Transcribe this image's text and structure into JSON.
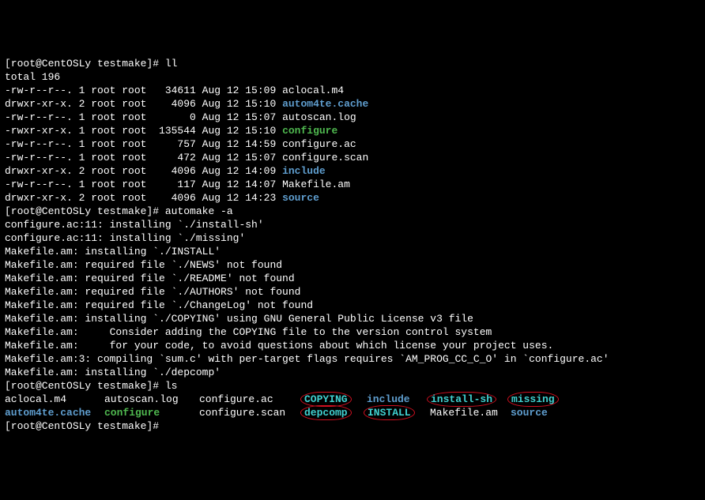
{
  "prompt": {
    "user": "root",
    "host": "CentOSLy",
    "dir": "testmake",
    "symbol": "#"
  },
  "cmd1": "ll",
  "total_line": "total 196",
  "listing": [
    {
      "perm": "-rw-r--r--.",
      "links": "1",
      "owner": "root",
      "group": "root",
      "size": "  34611",
      "date": "Aug 12 15:09",
      "name": "aclocal.m4",
      "cls": "white"
    },
    {
      "perm": "drwxr-xr-x.",
      "links": "2",
      "owner": "root",
      "group": "root",
      "size": "   4096",
      "date": "Aug 12 15:10",
      "name": "autom4te.cache",
      "cls": "dir"
    },
    {
      "perm": "-rw-r--r--.",
      "links": "1",
      "owner": "root",
      "group": "root",
      "size": "      0",
      "date": "Aug 12 15:07",
      "name": "autoscan.log",
      "cls": "white"
    },
    {
      "perm": "-rwxr-xr-x.",
      "links": "1",
      "owner": "root",
      "group": "root",
      "size": " 135544",
      "date": "Aug 12 15:10",
      "name": "configure",
      "cls": "exec"
    },
    {
      "perm": "-rw-r--r--.",
      "links": "1",
      "owner": "root",
      "group": "root",
      "size": "    757",
      "date": "Aug 12 14:59",
      "name": "configure.ac",
      "cls": "white"
    },
    {
      "perm": "-rw-r--r--.",
      "links": "1",
      "owner": "root",
      "group": "root",
      "size": "    472",
      "date": "Aug 12 15:07",
      "name": "configure.scan",
      "cls": "white"
    },
    {
      "perm": "drwxr-xr-x.",
      "links": "2",
      "owner": "root",
      "group": "root",
      "size": "   4096",
      "date": "Aug 12 14:09",
      "name": "include",
      "cls": "dir"
    },
    {
      "perm": "-rw-r--r--.",
      "links": "1",
      "owner": "root",
      "group": "root",
      "size": "    117",
      "date": "Aug 12 14:07",
      "name": "Makefile.am",
      "cls": "white"
    },
    {
      "perm": "drwxr-xr-x.",
      "links": "2",
      "owner": "root",
      "group": "root",
      "size": "   4096",
      "date": "Aug 12 14:23",
      "name": "source",
      "cls": "dir"
    }
  ],
  "cmd2": "automake -a",
  "automake_output": [
    "configure.ac:11: installing `./install-sh'",
    "configure.ac:11: installing `./missing'",
    "Makefile.am: installing `./INSTALL'",
    "Makefile.am: required file `./NEWS' not found",
    "Makefile.am: required file `./README' not found",
    "Makefile.am: required file `./AUTHORS' not found",
    "Makefile.am: required file `./ChangeLog' not found",
    "Makefile.am: installing `./COPYING' using GNU General Public License v3 file",
    "Makefile.am:     Consider adding the COPYING file to the version control system",
    "Makefile.am:     for your code, to avoid questions about which license your project uses.",
    "Makefile.am:3: compiling `sum.c' with per-target flags requires `AM_PROG_CC_C_O' in `configure.ac'",
    "Makefile.am: installing `./depcomp'"
  ],
  "cmd3": "ls",
  "ls_cols": {
    "row1": [
      {
        "txt": "aclocal.m4",
        "cls": "white",
        "circled": false
      },
      {
        "txt": "autoscan.log",
        "cls": "white",
        "circled": false
      },
      {
        "txt": "configure.ac",
        "cls": "white",
        "circled": false
      },
      {
        "txt": "COPYING",
        "cls": "link",
        "circled": true
      },
      {
        "txt": "include",
        "cls": "dir",
        "circled": false
      },
      {
        "txt": "install-sh",
        "cls": "link",
        "circled": true
      },
      {
        "txt": "missing",
        "cls": "link",
        "circled": true
      }
    ],
    "row2": [
      {
        "txt": "autom4te.cache",
        "cls": "dir",
        "circled": false
      },
      {
        "txt": "configure",
        "cls": "exec",
        "circled": false
      },
      {
        "txt": "configure.scan",
        "cls": "white",
        "circled": false
      },
      {
        "txt": "depcomp",
        "cls": "link",
        "circled": true
      },
      {
        "txt": "INSTALL",
        "cls": "link",
        "circled": true
      },
      {
        "txt": "Makefile.am",
        "cls": "white",
        "circled": false
      },
      {
        "txt": "source",
        "cls": "dir",
        "circled": false
      }
    ]
  }
}
